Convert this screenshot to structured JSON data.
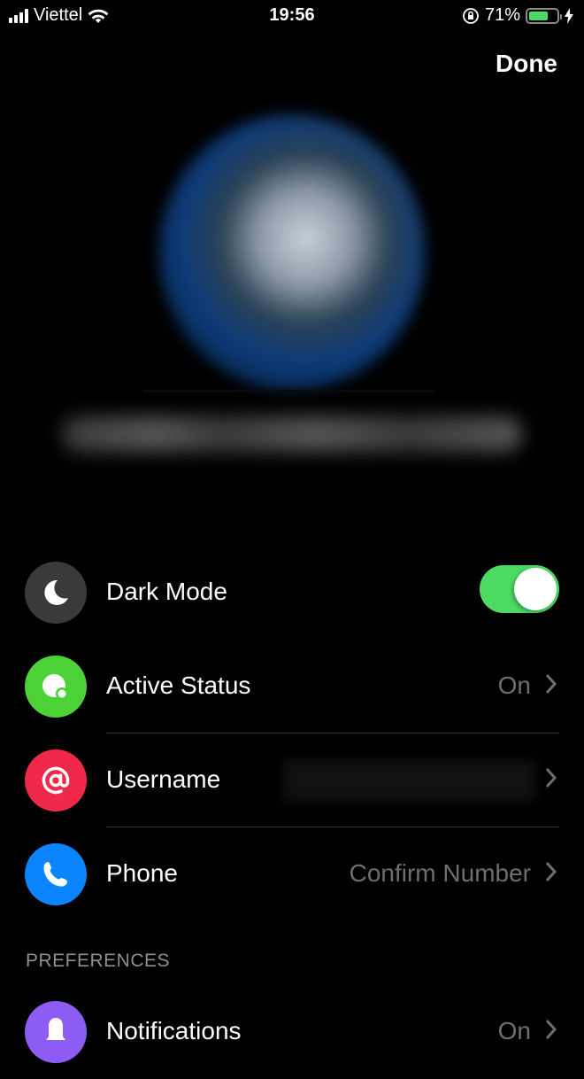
{
  "status_bar": {
    "carrier": "Viettel",
    "time": "19:56",
    "battery_percent_label": "71%",
    "battery_level": 0.71,
    "icons": [
      "signal-icon",
      "wifi-icon",
      "rotation-lock-icon",
      "battery-icon",
      "charging-icon"
    ]
  },
  "header": {
    "done_label": "Done"
  },
  "profile": {
    "avatar": "blurred-avatar",
    "name": ""
  },
  "settings": [
    {
      "id": "dark-mode",
      "label": "Dark Mode",
      "icon": "moon-icon",
      "icon_color": "#3a3a3c",
      "control": "toggle",
      "toggle_on": true,
      "toggle_color": "#4cd964"
    },
    {
      "id": "active-status",
      "label": "Active Status",
      "icon": "active-status-icon",
      "icon_color": "#4cd137",
      "value": "On",
      "control": "chevron"
    },
    {
      "id": "username",
      "label": "Username",
      "icon": "at-icon",
      "icon_color": "#f0284a",
      "value": "",
      "control": "chevron"
    },
    {
      "id": "phone",
      "label": "Phone",
      "icon": "phone-icon",
      "icon_color": "#0a84ff",
      "value": "Confirm Number",
      "control": "chevron"
    }
  ],
  "preferences": {
    "header": "PREFERENCES",
    "items": [
      {
        "id": "notifications",
        "label": "Notifications",
        "icon": "bell-icon",
        "icon_color": "#8e5cf5",
        "value": "On",
        "control": "chevron"
      }
    ]
  }
}
